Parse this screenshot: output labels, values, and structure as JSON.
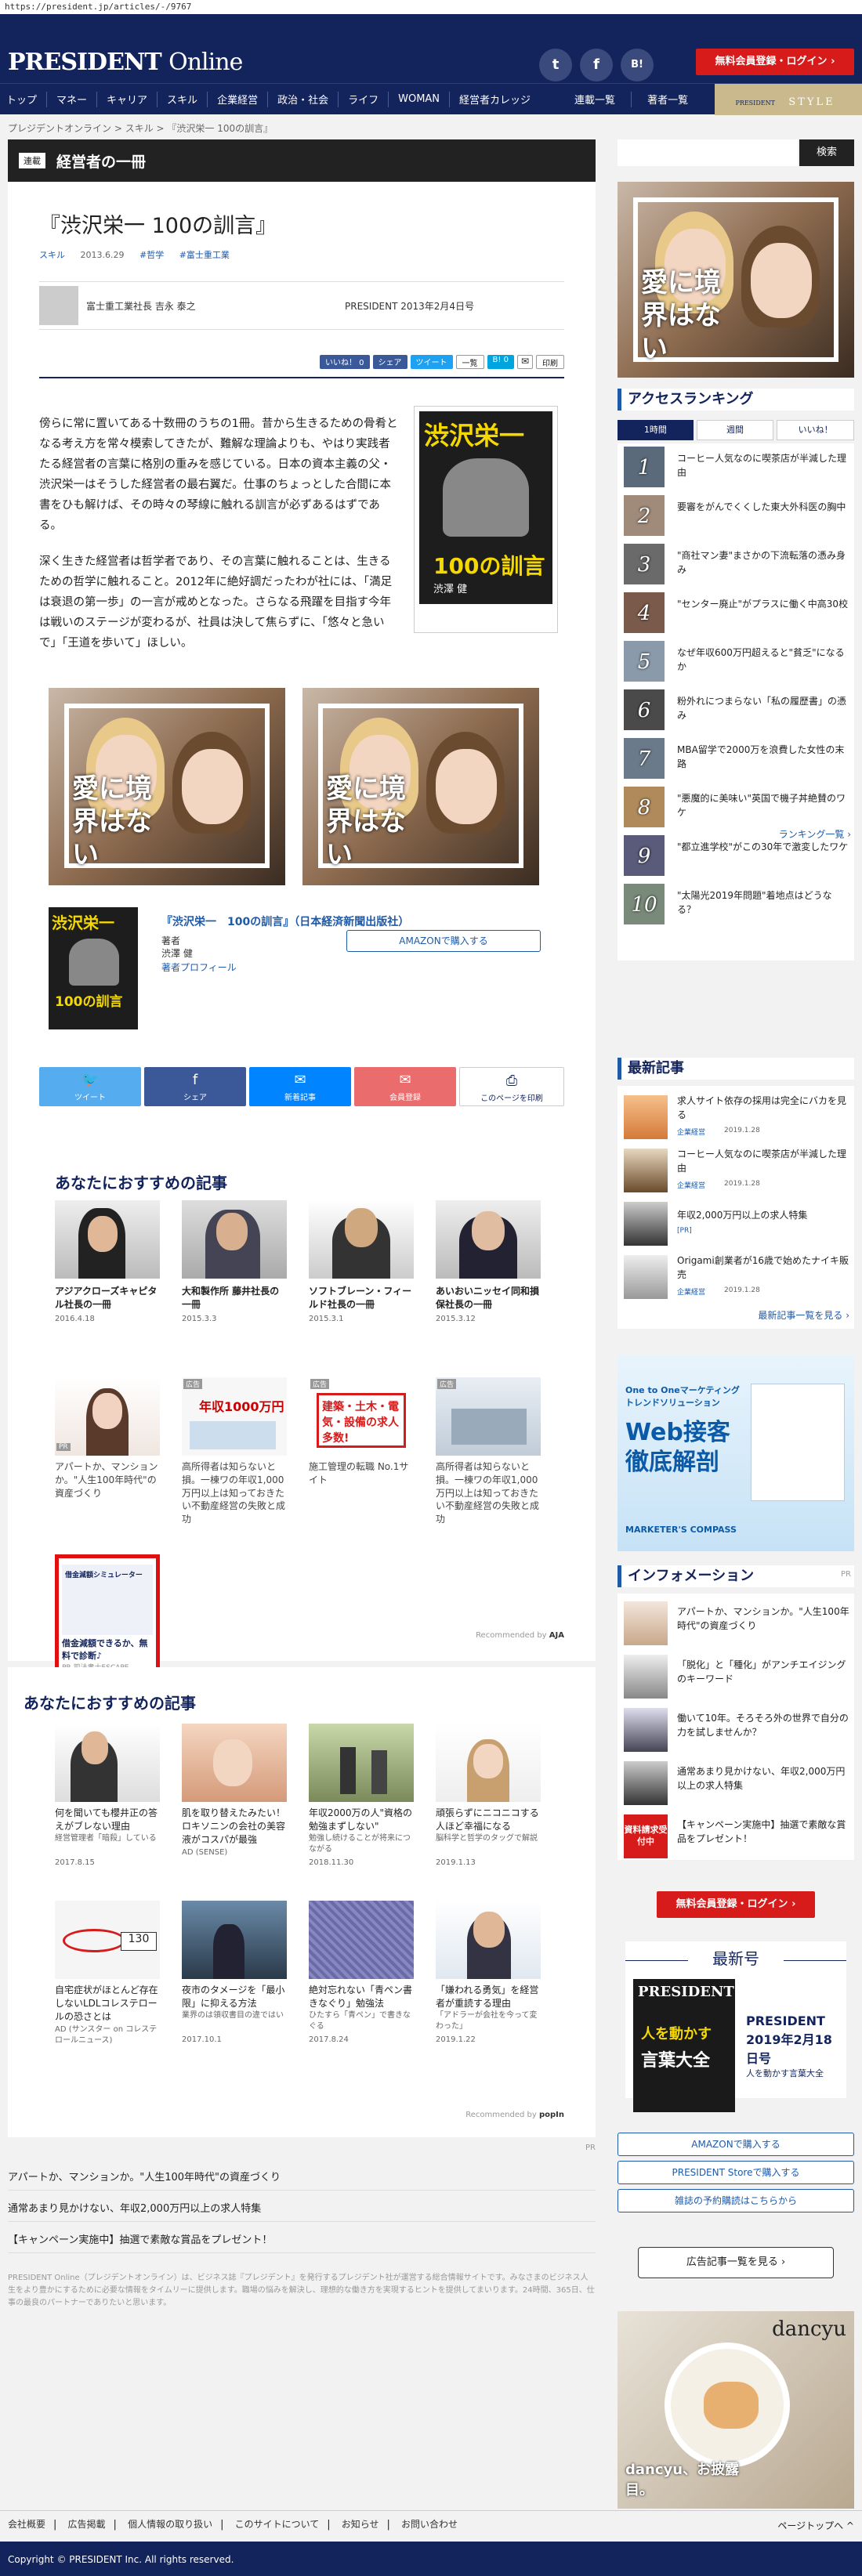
{
  "url": "https://president.jp/articles/-/9767",
  "header": {
    "logo_main": "PRESIDENT",
    "logo_online": "Online",
    "sns": [
      "t",
      "f",
      "B!"
    ],
    "register_button": "無料会員登録・ログイン ›"
  },
  "nav": {
    "items": [
      "トップ",
      "マネー",
      "キャリア",
      "スキル",
      "企業経営",
      "政治・社会",
      "ライフ",
      "WOMAN",
      "経営者カレッジ"
    ],
    "right_items": [
      "連載一覧",
      "著者一覧"
    ],
    "style_small": "PRESIDENT",
    "style_label": "STYLE"
  },
  "breadcrumb": [
    "プレジデントオンライン",
    "スキル",
    "『渋沢栄一 100の訓言』"
  ],
  "article": {
    "section_tag": "連載",
    "section_title": "経営者の一冊",
    "title": "『渋沢栄一 100の訓言』",
    "category": "スキル",
    "date": "2013.6.29",
    "tags": [
      "#哲学",
      "#富士重工業"
    ],
    "author": "富士重工業社長 吉永 泰之",
    "source": "PRESIDENT 2013年2月4日号",
    "share_buttons": [
      "いいね！ 0",
      "シェア",
      "ツイート",
      "一覧",
      "B! 0",
      "✉",
      "印刷"
    ],
    "paragraph1": "傍らに常に置いてある十数冊のうちの1冊。昔から生きるための骨肴となる考え方を常々模索してきたが、難解な理論よりも、やはり実践者たる経営者の言葉に格別の重みを感じている。日本の資本主義の父・渋沢栄一はそうした経営者の最右翼だ。仕事のちょっとした合間に本書をひも解けば、その時々の琴線に触れる訓言が必ずあるはずである。",
    "paragraph2": "深く生きた経営者は哲学者であり、その言葉に触れることは、生きるための哲学に触れること。2012年に絶好調だったわが社には、「満足は衰退の第一歩」の一言が戒めとなった。さらなる飛躍を目指す今年は戦いのステージが変わるが、社員は決して焦らずに、「悠々と急いで」「王道を歩いて」ほしい。",
    "book_cover_name": "渋沢栄一",
    "book_cover_sub": "100の訓言",
    "book_cover_author": "渋澤 健",
    "book_title": "『渋沢栄一　100の訓言』（日本経済新聞出版社）",
    "book_author_label": "著者",
    "book_author": "渋澤 健",
    "book_author_profile": "著者プロフィール",
    "amazon_button": "AMAZONで購入する",
    "ad_text": "愛に境界はない",
    "share_bar": [
      "ツイート",
      "シェア",
      "新着記事",
      "会員登録",
      "このページを印刷"
    ]
  },
  "recommend1": {
    "heading": "あなたにおすすめの記事",
    "items": [
      {
        "title": "アジアクローズキャピタル社長の一冊",
        "date": "2016.4.18"
      },
      {
        "title": "大和製作所 藤井社長の一冊",
        "date": "2015.3.3"
      },
      {
        "title": "ソフトブレーン・フィールド社長の一冊",
        "date": "2015.3.1"
      },
      {
        "title": "あいおいニッセイ同和損保社長の一冊",
        "date": "2015.3.12"
      }
    ],
    "ads": [
      {
        "badge": "PR",
        "title": "アパートか、マンションか。\"人生100年時代\"の資産づくり"
      },
      {
        "badge": "広告",
        "title": "高所得者は知らないと損。一棟ワの年収1,000万円以上は知っておきたい不動産経営の失敗と成功"
      },
      {
        "badge": "広告",
        "title": "施工管理の転職 No.1サイト"
      },
      {
        "badge": "広告",
        "title": "高所得者は知らないと損。一棟ワの年収1,000万円以上は知っておきたい不動産経営の失敗と成功"
      }
    ],
    "ad_banner_1000": "年収1000万円",
    "ad_banner_build": "建築・土木・電気・設備の求人多数!",
    "ad5_title": "借金減額できるか、無料で診断♪",
    "ad5_source": "PR 司法書士ESCAPE",
    "ad5_header": "借金減額シミュレーター",
    "recommended_by": "Recommended by",
    "recommended_brand": "AJA"
  },
  "recommend2": {
    "heading": "あなたにおすすめの記事",
    "items": [
      {
        "title": "何を聞いても櫻井正の答えがブレない理由",
        "sub": "経営管理者「暗殺」している",
        "date": "2017.8.15"
      },
      {
        "title": "肌を取り替えたみたい！ロキソニンの会社の美容液がコスパが最強",
        "sub": "AD (SENSE)",
        "date": ""
      },
      {
        "title": "年収2000万の人\"資格の勉強まずしない\"",
        "sub": "勉強し続けることが将来につながる",
        "date": "2018.11.30"
      },
      {
        "title": "頑張らずにニコニコする人ほど幸福になる",
        "sub": "脳科学と哲学のタッグで解説",
        "date": "2019.1.13"
      },
      {
        "title": "自宅症状がほとんど存在しないLDLコレステロールの恐さとは",
        "sub": "AD (サンスター on コレステロールニュース)",
        "date": ""
      },
      {
        "title": "夜市のタメージを「最小限」に抑える方法",
        "sub": "業界のは領収書目の違ではい",
        "date": "2017.10.1"
      },
      {
        "title": "絶対忘れない「青ペン書きなぐり」勉強法",
        "sub": "ひたすら「青ペン」で書きなぐる",
        "date": "2017.8.24"
      },
      {
        "title": "「嫌われる勇気」を経営者が重読する理由",
        "sub": "「アドラーが会社を今って変わった」",
        "date": "2019.1.22"
      }
    ],
    "recommended_by": "Recommended by",
    "recommended_brand": "popIn"
  },
  "bottom_links": {
    "pr": "PR",
    "items": [
      "アパートか、マンションか。\"人生100年時代\"の資産づくり",
      "通常あまり見かけない、年収2,000万円以上の求人特集",
      "【キャンペーン実施中】抽選で素敵な賞品をプレゼント！"
    ],
    "about": "PRESIDENT Online（プレジデントオンライン）は、ビジネス誌『プレジデント』を発行するプレジデント社が運営する総合情報サイトです。みなさまのビジネス人生をより豊かにするために必要な情報をタイムリーに提供します。職場の悩みを解決し、理想的な働き方を実現するヒントを提供してまいります。24時間、365日、仕事の最良のパートナーでありたいと思います。"
  },
  "sidebar": {
    "search_button": "検索",
    "ranking_heading": "アクセスランキング",
    "ranking_tabs": [
      "1時間",
      "週間",
      "いいね！"
    ],
    "ranking": [
      "コーヒー人気なのに喫茶店が半減した理由",
      "要審をがんでくくした東大外科医の胸中",
      "\"商社マン妻\"まさかの下流転落の憑み身み",
      "\"センター廃止\"がプラスに働く中高30校",
      "なぜ年収600万円超えると\"貧乏\"になるか",
      "粉外れにつまらない「私の履歴書」の憑み",
      "MBA留学で2000万を浪費した女性の末路",
      "\"悪魔的に美味い\"英国で機子丼絶賛のワケ",
      "\"都立進学校\"がこの30年で激変したワケ",
      "\"太陽光2019年問題\"着地点はどうなる？"
    ],
    "ranking_more": "ランキング一覧 ›",
    "latest_heading": "最新記事",
    "latest": [
      {
        "title": "求人サイト依存の採用は完全にバカを見る",
        "tag": "企業経営",
        "date": "2019.1.28"
      },
      {
        "title": "コーヒー人気なのに喫茶店が半減した理由",
        "tag": "企業経営",
        "date": "2019.1.28"
      },
      {
        "title": "年収2,000万円以上の求人特集",
        "tag": "[PR]",
        "date": ""
      },
      {
        "title": "Origami創業者が16歳で始めたナイキ販売",
        "tag": "企業経営",
        "date": "2019.1.28"
      }
    ],
    "latest_more": "最新記事一覧を見る ›",
    "ad_web_small": "One to Oneマーケティング トレンドソリューション",
    "ad_web_big": "Web接客 徹底解剖",
    "ad_web_brand": "MARKETER'S COMPASS",
    "info_heading": "インフォメーション",
    "info_pr": "PR",
    "info": [
      "アパートか、マンションか。\"人生100年時代\"の資産づくり",
      "「脱化」と「種化」がアンチエイジングのキーワード",
      "働いて10年。そろそろ外の世界で自分の力を試しませんか？",
      "通常あまり見かけない、年収2,000万円以上の求人特集",
      "【キャンペーン実施中】抽選で素敵な賞品をプレゼント！"
    ],
    "info_badge": "資料請求受付中",
    "register_button": "無料会員登録・ログイン ›",
    "latest_issue_heading": "最新号",
    "issue_title": "PRESIDENT 2019年2月18日号",
    "issue_sub": "人を動かす言葉大全",
    "issue_cover_small": "人を動かす",
    "issue_cover_big": "言葉大全",
    "issue_buttons": [
      "AMAZONで購入する",
      "PRESIDENT Storeで購入する",
      "雑誌の予約購読はこちらから"
    ],
    "ad_list_button": "広告記事一覧を見る ›",
    "dancyu": "dancyu",
    "dancyu_text": "dancyu、お披露目。"
  },
  "footer": {
    "links": [
      "会社概要",
      "広告掲載",
      "個人情報の取り扱い",
      "このサイトについて",
      "お知らせ",
      "お問い合わせ"
    ],
    "pagetop": "ページトップへ ^",
    "copyright": "Copyright © PRESIDENT Inc. All rights reserved."
  }
}
